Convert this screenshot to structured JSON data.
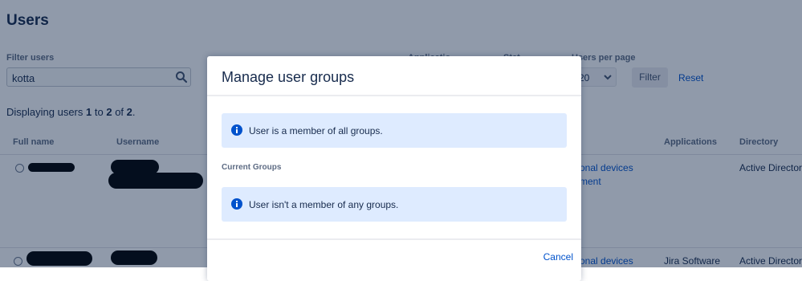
{
  "page": {
    "title": "Users",
    "filter_label": "Filter users",
    "filter_value": "kotta",
    "hidden_labels": {
      "applications_partial": "Applicatio",
      "status_partial": "Stat"
    },
    "users_per_page_label": "Users per page",
    "users_per_page_value": "20",
    "filter_button": "Filter",
    "reset_link": "Reset",
    "displaying": {
      "prefix": "Displaying users",
      "from": "1",
      "to_word": "to",
      "to": "2",
      "of_word": "of",
      "total": "2",
      "suffix": "."
    },
    "table": {
      "headers": [
        "Full name",
        "Username",
        "Applications",
        "Directory"
      ],
      "rows": [
        {
          "groups_partial": [
            "onal devices",
            "ment"
          ],
          "applications": "",
          "directory": "Active Director"
        },
        {
          "groups_partial": [
            "onal devices"
          ],
          "applications": "Jira Software",
          "directory": "Active Director"
        }
      ]
    }
  },
  "modal": {
    "title": "Manage user groups",
    "info_all_groups": "User is a member of all groups.",
    "current_groups_label": "Current Groups",
    "info_no_groups": "User isn't a member of any groups.",
    "cancel": "Cancel"
  },
  "colors": {
    "link": "#0052cc",
    "info_bg": "#deebff",
    "info_icon": "#0052cc",
    "overlay": "rgba(9,30,66,0.45)"
  },
  "icons": [
    "search-icon",
    "chevron-down-icon",
    "info-icon",
    "avatar"
  ]
}
